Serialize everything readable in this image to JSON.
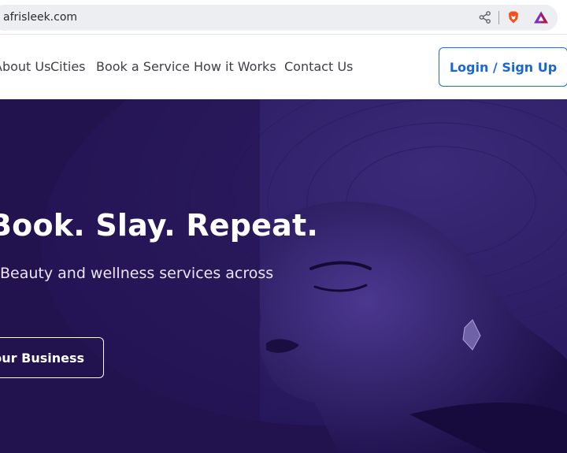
{
  "browser": {
    "url": "afrisleek.com",
    "icons": [
      "share-icon",
      "brave-shield-icon",
      "bat-rewards-icon"
    ]
  },
  "nav": {
    "items": [
      {
        "label": "About Us"
      },
      {
        "label": "Cities"
      },
      {
        "label": "Book a Service"
      },
      {
        "label": "How it Works"
      },
      {
        "label": "Contact Us"
      }
    ],
    "login_label": "Login / Sign Up"
  },
  "hero": {
    "title": "Book. Slay. Repeat.",
    "subtitle": "Beauty and wellness services across",
    "cta_label": "List Your Business"
  },
  "colors": {
    "hero_bg": "#22134f",
    "accent": "#1a67d2",
    "nav_text": "#3f3f46"
  }
}
